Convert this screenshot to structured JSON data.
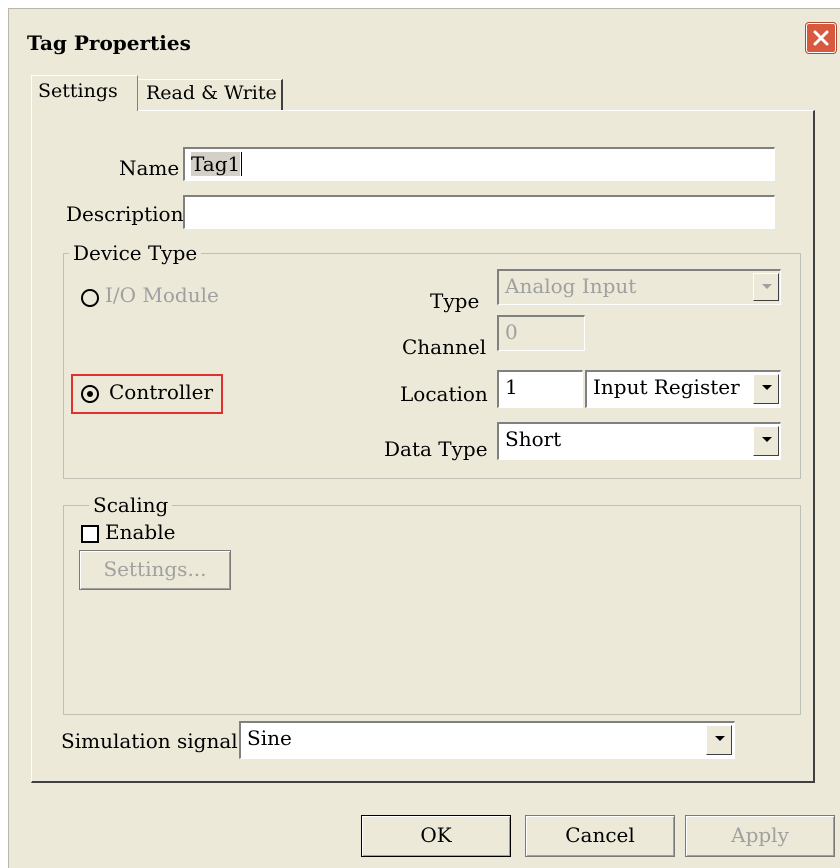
{
  "window": {
    "title": "Tag Properties"
  },
  "tabs": [
    {
      "label": "Settings"
    },
    {
      "label": "Read & Write"
    }
  ],
  "name": {
    "label": "Name",
    "value": "Tag1"
  },
  "description": {
    "label": "Description",
    "value": ""
  },
  "device_type": {
    "legend": "Device Type",
    "io_module_label": "I/O Module",
    "controller_label": "Controller",
    "selected": "Controller",
    "type_label": "Type",
    "type_value": "Analog Input",
    "channel_label": "Channel",
    "channel_value": "0",
    "location_label": "Location",
    "location_value": "1",
    "register_value": "Input Register",
    "data_type_label": "Data Type",
    "data_type_value": "Short"
  },
  "scaling": {
    "legend": "Scaling",
    "enable_label": "Enable",
    "enabled": false,
    "settings_label": "Settings..."
  },
  "simulation": {
    "label": "Simulation signal",
    "value": "Sine"
  },
  "buttons": {
    "ok": "OK",
    "cancel": "Cancel",
    "apply": "Apply"
  },
  "colors": {
    "dialog_bg": "#ece9d8",
    "highlight_border": "#e03030",
    "close_button": "#d9593e"
  }
}
